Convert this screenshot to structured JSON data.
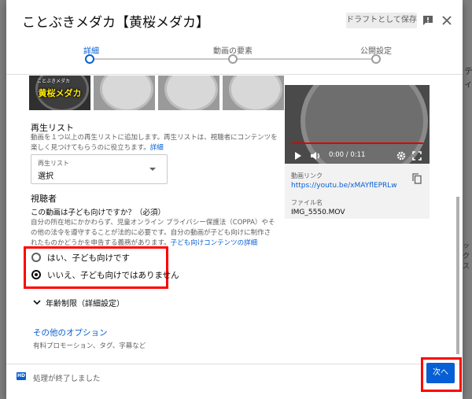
{
  "dialog": {
    "title": "ことぶきメダカ【黄桜メダカ】",
    "draft_label": "ドラフトとして保存",
    "feedback_icon": "feedback-icon",
    "close_icon": "close-icon"
  },
  "stepper": {
    "steps": [
      {
        "label": "詳細",
        "active": true
      },
      {
        "label": "動画の要素",
        "active": false
      },
      {
        "label": "公開設定",
        "active": false
      }
    ]
  },
  "thumbnails": {
    "overlay_text": "黄桜メダカ",
    "overlay_small_text": "ことぶきメダカ"
  },
  "playlist": {
    "title": "再生リスト",
    "description": "動画を１つ以上の再生リストに追加します。再生リストは、視聴者にコンテンツを楽しく見つけてもらうのに役立ちます。",
    "details_link": "詳細",
    "select_caption": "再生リスト",
    "select_value": "選択"
  },
  "audience": {
    "title": "視聴者",
    "question": "この動画は子ども向けですか？（必須）",
    "description": "自分の所在地にかかわらず、児童オンライン プライバシー保護法（COPPA）やその他の法令を遵守することが法的に必要です。自分の動画が子ども向けに制作されたものかどうかを申告する義務があります。",
    "link": "子ども向けコンテンツの詳細",
    "options": [
      {
        "label": "はい、子ども向けです",
        "checked": false
      },
      {
        "label": "いいえ、子ども向けではありません",
        "checked": true
      }
    ]
  },
  "age_restriction": {
    "label": "年齢制限（詳細設定）"
  },
  "more_options": {
    "label": "その他のオプション",
    "description": "有料プロモーション、タグ、字幕など"
  },
  "video": {
    "time": "0:00 / 0:11",
    "link_caption": "動画リンク",
    "link_value": "https://youtu.be/xMAYflEPRLw",
    "file_caption": "ファイル名",
    "file_value": "IMG_5550.MOV"
  },
  "footer": {
    "badge": "HD",
    "status": "処理が終了しました",
    "next_label": "次へ"
  },
  "backdrop": {
    "right_top": "ティ",
    "right_mid": "ックス"
  },
  "colors": {
    "accent": "#065fd4",
    "highlight": "#ff0000"
  }
}
